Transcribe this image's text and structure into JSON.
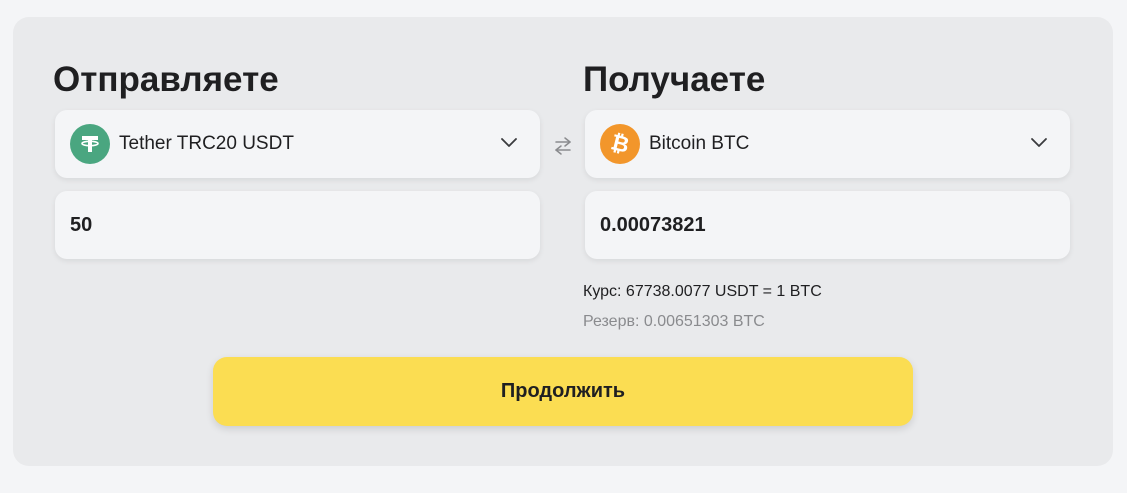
{
  "send": {
    "title": "Отправляете",
    "currency_label": "Tether TRC20 USDT",
    "currency_icon": "tether-icon",
    "amount": "50"
  },
  "receive": {
    "title": "Получаете",
    "currency_label": "Bitcoin BTC",
    "currency_icon": "bitcoin-icon",
    "amount": "0.00073821"
  },
  "info": {
    "rate": "Курс: 67738.0077 USDT = 1 BTC",
    "reserve": "Резерв: 0.00651303 BTC"
  },
  "actions": {
    "continue_label": "Продолжить"
  },
  "colors": {
    "tether": "#4aa680",
    "bitcoin": "#f2962b",
    "button": "#fbdd52",
    "card": "#e9eaec"
  }
}
